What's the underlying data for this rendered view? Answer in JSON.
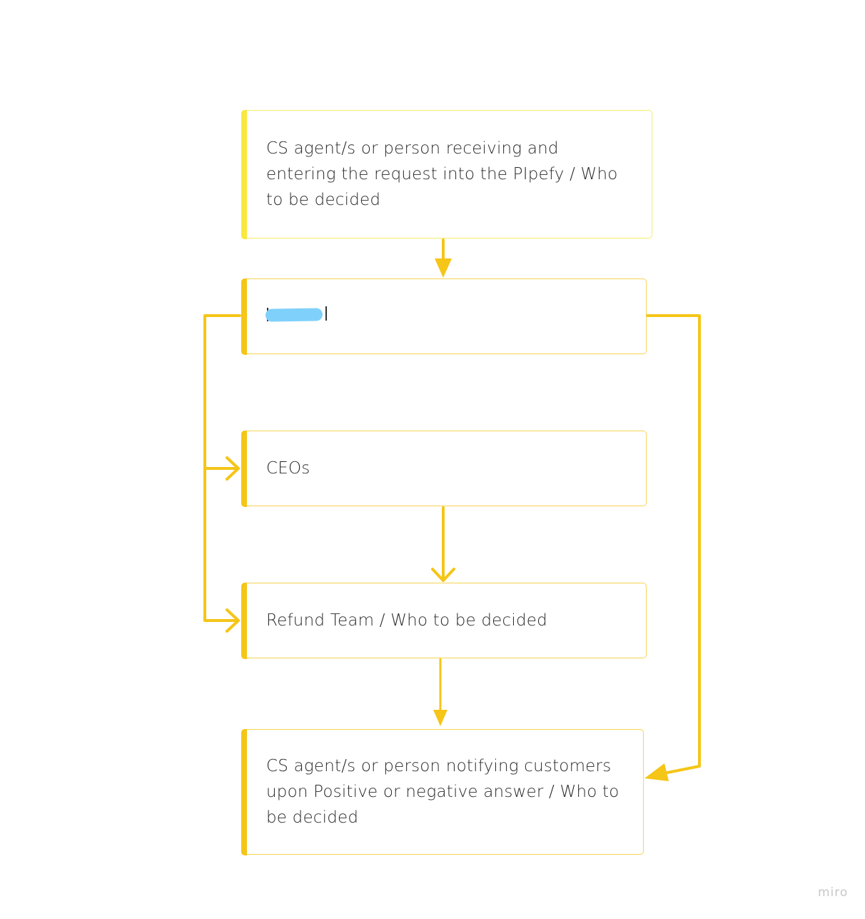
{
  "diagram": {
    "type": "flowchart",
    "accent_color": "#f5c518",
    "nodes": [
      {
        "id": "receive",
        "label": "CS agent/s or person receiving and entering the request into the PIpefy / Who to be decided"
      },
      {
        "id": "redacted",
        "label": "N        l",
        "redacted": true
      },
      {
        "id": "ceos",
        "label": "CEOs"
      },
      {
        "id": "refund",
        "label": "Refund Team / Who to be decided"
      },
      {
        "id": "notify",
        "label": "CS agent/s or person notifying customers upon Positive or negative answer / Who to be decided"
      }
    ],
    "edges": [
      {
        "from": "receive",
        "to": "redacted",
        "arrow": "filled"
      },
      {
        "from": "redacted",
        "to": "ceos",
        "arrow": "open",
        "route": "left"
      },
      {
        "from": "redacted",
        "to": "refund",
        "arrow": "open",
        "route": "left"
      },
      {
        "from": "ceos",
        "to": "refund",
        "arrow": "open"
      },
      {
        "from": "refund",
        "to": "notify",
        "arrow": "filled"
      },
      {
        "from": "redacted",
        "to": "notify",
        "arrow": "filled",
        "route": "right"
      }
    ]
  },
  "watermark": "miro"
}
